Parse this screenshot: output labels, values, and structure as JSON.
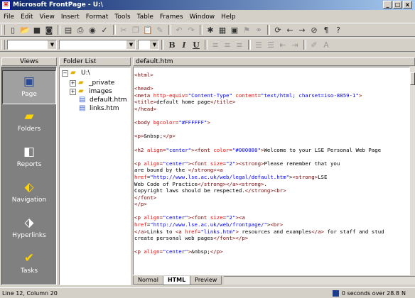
{
  "window": {
    "title": "Microsoft FrontPage - U:\\",
    "buttons": {
      "minimize": "_",
      "maximize": "□",
      "close": "x"
    }
  },
  "menubar": [
    "File",
    "Edit",
    "View",
    "Insert",
    "Format",
    "Tools",
    "Table",
    "Frames",
    "Window",
    "Help"
  ],
  "toolbar2": {
    "style_value": "",
    "font_value": "",
    "size_value": "",
    "bold": "B",
    "italic": "I",
    "underline": "U"
  },
  "views": {
    "header": "Views",
    "items": [
      {
        "label": "Page",
        "icon": "page-icon",
        "selected": true
      },
      {
        "label": "Folders",
        "icon": "folders-icon"
      },
      {
        "label": "Reports",
        "icon": "reports-icon"
      },
      {
        "label": "Navigation",
        "icon": "navigation-icon"
      },
      {
        "label": "Hyperlinks",
        "icon": "hyperlinks-icon"
      },
      {
        "label": "Tasks",
        "icon": "tasks-icon"
      }
    ]
  },
  "folder_list": {
    "header": "Folder List",
    "root": "U:\\",
    "items": [
      "_private",
      "images",
      "default.htm",
      "links.htm"
    ]
  },
  "editor": {
    "filename": "default.htm",
    "tabs": [
      "Normal",
      "HTML",
      "Preview"
    ],
    "active_tab": "HTML",
    "lines": [
      "<html>",
      "",
      "<head>",
      "<meta http-equiv=\"Content-Type\" content=\"text/html; charset=iso-8859-1\">",
      "<title>default home page</title>",
      "</head>",
      "",
      "<body bgcolor=\"#FFFFFF\">",
      "",
      "<p>&nbsp;</p>",
      "",
      "<h2 align=\"center\"><font color=\"#000080\">Welcome to your LSE Personal Web Page",
      "",
      "<p align=\"center\"><font size=\"2\"><strong>Please remember that you",
      "are bound by the </strong><a",
      "href=\"http://www.lse.ac.uk/web/legal/default.htm\"><strong>LSE",
      "Web Code of Practice</strong></a><strong>.",
      "Copyright laws should be respected.</strong><br>",
      "</font>",
      "</p>",
      "",
      "<p align=\"center\"><font size=\"2\"><a",
      "href=\"http://www.lse.ac.uk/web/frontpage/\"><br>",
      "</a>Links to <a href=\"links.htm\"> resources and examples</a> for staff and stud",
      "create personal web pages</font></p>",
      "",
      "<p align=\"center\">&nbsp;</p>"
    ]
  },
  "status": {
    "position": "Line 12, Column 20",
    "time": "0 seconds over 28.8",
    "mode": "N"
  }
}
